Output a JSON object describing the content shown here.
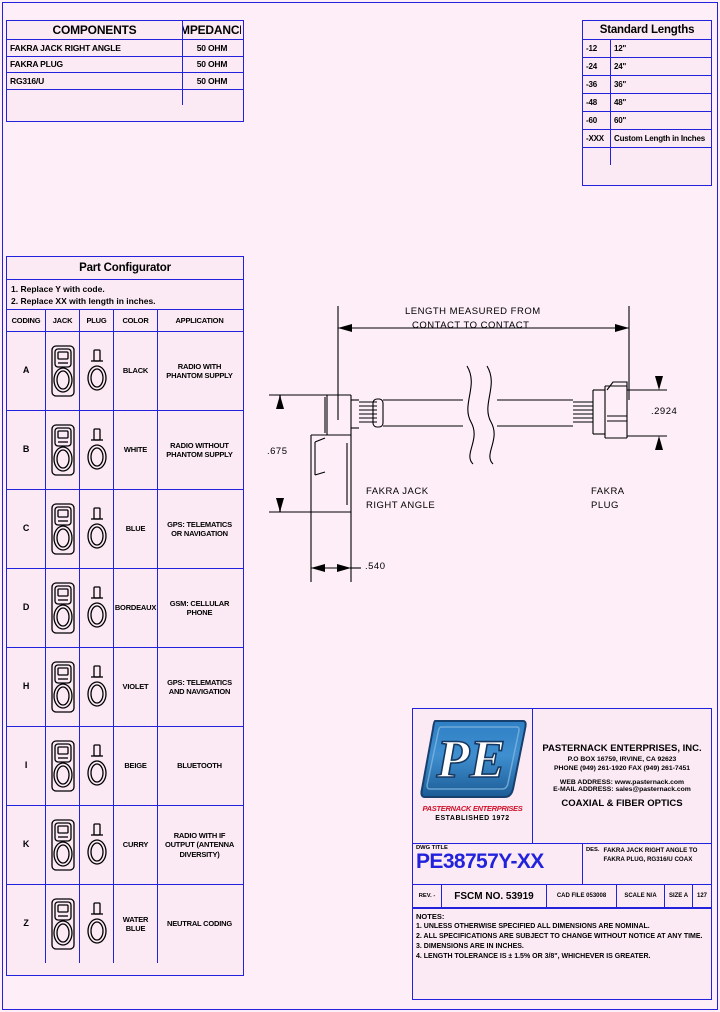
{
  "components_table": {
    "headers": [
      "COMPONENTS",
      "IMPEDANCE"
    ],
    "rows": [
      {
        "component": "FAKRA JACK RIGHT ANGLE",
        "impedance": "50 OHM"
      },
      {
        "component": "FAKRA PLUG",
        "impedance": "50 OHM"
      },
      {
        "component": "RG316/U",
        "impedance": "50 OHM"
      },
      {
        "component": "",
        "impedance": ""
      }
    ]
  },
  "lengths_table": {
    "title": "Standard Lengths",
    "rows": [
      {
        "code": "-12",
        "length": "12\""
      },
      {
        "code": "-24",
        "length": "24\""
      },
      {
        "code": "-36",
        "length": "36\""
      },
      {
        "code": "-48",
        "length": "48\""
      },
      {
        "code": "-60",
        "length": "60\""
      },
      {
        "code": "-XXX",
        "length": "Custom Length in Inches"
      },
      {
        "code": "",
        "length": ""
      }
    ]
  },
  "configurator": {
    "title": "Part Configurator",
    "note1": "1.  Replace Y with code.",
    "note2": "2.  Replace XX with length in inches.",
    "headers": [
      "CODING",
      "JACK",
      "PLUG",
      "COLOR",
      "APPLICATION"
    ],
    "rows": [
      {
        "coding": "A",
        "color": "BLACK",
        "application": "RADIO WITH PHANTOM SUPPLY"
      },
      {
        "coding": "B",
        "color": "WHITE",
        "application": "RADIO WITHOUT PHANTOM SUPPLY"
      },
      {
        "coding": "C",
        "color": "BLUE",
        "application": "GPS: TELEMATICS OR NAVIGATION"
      },
      {
        "coding": "D",
        "color": "BORDEAUX",
        "application": "GSM: CELLULAR PHONE"
      },
      {
        "coding": "H",
        "color": "VIOLET",
        "application": "GPS: TELEMATICS AND NAVIGATION"
      },
      {
        "coding": "I",
        "color": "BEIGE",
        "application": "BLUETOOTH"
      },
      {
        "coding": "K",
        "color": "CURRY",
        "application": "RADIO WITH IF OUTPUT (ANTENNA DIVERSITY)"
      },
      {
        "coding": "Z",
        "color": "WATER BLUE",
        "application": "NEUTRAL CODING"
      }
    ]
  },
  "drawing": {
    "length_note_line1": "LENGTH MEASURED FROM",
    "length_note_line2": "CONTACT TO CONTACT",
    "dim_height": ".675",
    "dim_width": ".540",
    "dim_plug": ".2924",
    "label_left_line1": "FAKRA JACK",
    "label_left_line2": "RIGHT ANGLE",
    "label_right_line1": "FAKRA",
    "label_right_line2": "PLUG"
  },
  "title_block": {
    "logo_initials": "PE",
    "logo_subtitle": "PASTERNACK ENTERPRISES",
    "logo_established": "ESTABLISHED 1972",
    "company_name": "PASTERNACK ENTERPRISES, INC.",
    "address": "P.O BOX 16759, IRVINE, CA 92623",
    "phone": "PHONE (949) 261-1920 FAX (949) 261-7451",
    "web": "WEB ADDRESS: www.pasternack.com",
    "email": "E-MAIL ADDRESS: sales@pasternack.com",
    "tagline": "COAXIAL & FIBER OPTICS",
    "dwg_title_label": "DWG TITLE",
    "part_number": "PE38757Y-XX",
    "des_label": "DES.",
    "description": "FAKRA JACK RIGHT ANGLE TO FAKRA PLUG, RG316/U COAX",
    "rev_label": "REV. -",
    "fscm": "FSCM NO.  53919",
    "cad_file": "CAD FILE    053008",
    "scale": "SCALE  N/A",
    "size": "SIZE  A",
    "sheet": "127",
    "accent_color": "#2222dd"
  },
  "notes": {
    "title": "NOTES:",
    "items": [
      "1.  UNLESS OTHERWISE SPECIFIED ALL DIMENSIONS ARE NOMINAL.",
      "2.  ALL SPECIFICATIONS ARE SUBJECT TO CHANGE WITHOUT NOTICE AT ANY TIME.",
      "3.  DIMENSIONS ARE IN INCHES.",
      "4.  LENGTH TOLERANCE IS ± 1.5% OR 3/8\", WHICHEVER IS GREATER."
    ]
  }
}
